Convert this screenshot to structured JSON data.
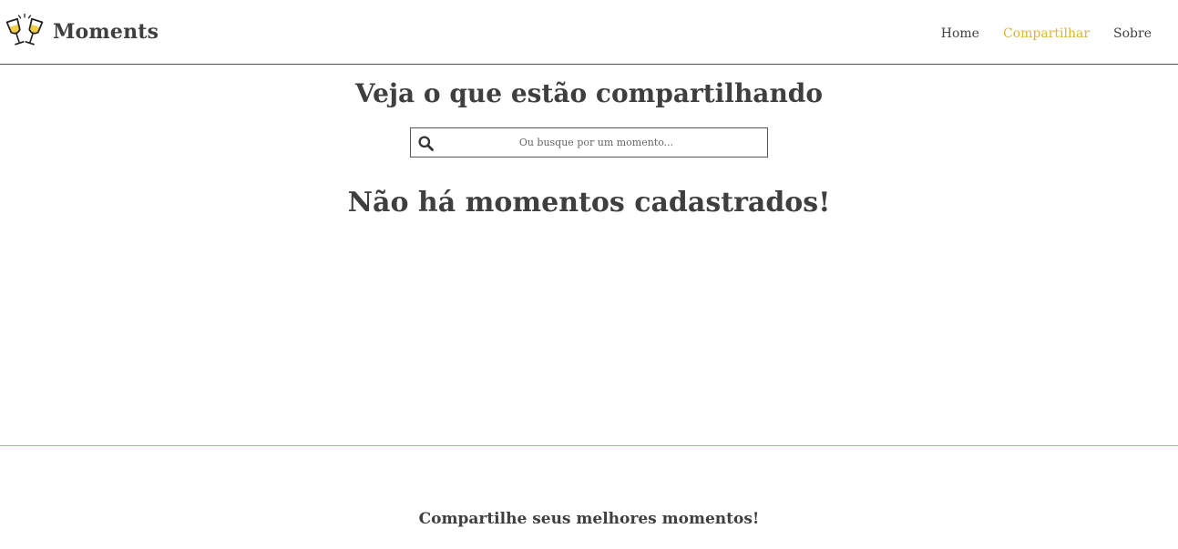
{
  "navbar": {
    "brand_title": "Moments",
    "logo_icon": "champagne-toast-icon",
    "links": [
      {
        "label": "Home",
        "active": false
      },
      {
        "label": "Compartilhar",
        "active": true
      },
      {
        "label": "Sobre",
        "active": false
      }
    ]
  },
  "main": {
    "title": "Veja o que estão compartilhando",
    "search": {
      "placeholder": "Ou busque por um momento...",
      "value": "",
      "icon": "search-icon"
    },
    "empty_message": "Não há momentos cadastrados!"
  },
  "footer": {
    "text": "Compartilhe seus melhores momentos!"
  },
  "colors": {
    "accent": "#d9b534",
    "text": "#3f3f3f",
    "border": "#555555",
    "background": "#ffffff"
  }
}
